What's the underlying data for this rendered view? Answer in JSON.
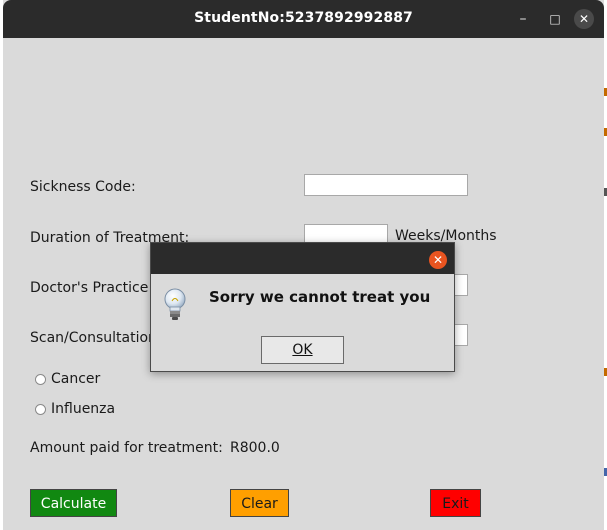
{
  "window": {
    "title": "StudentNo:5237892992887"
  },
  "form": {
    "sickness_code_label": "Sickness Code:",
    "sickness_code_value": "",
    "duration_label": "Duration of Treatment:",
    "duration_value": "",
    "duration_unit": "Weeks/Months",
    "doctor_label": "Doctor's Practice N",
    "scan_label": "Scan/Consultation",
    "radio_options": [
      "Cancer",
      "Influenza"
    ],
    "amount_label": "Amount paid for treatment:",
    "amount_value": "R800.0"
  },
  "buttons": {
    "calculate": "Calculate",
    "clear": "Clear",
    "exit": "Exit"
  },
  "dialog": {
    "message": "Sorry we cannot treat you",
    "ok_label": "OK",
    "icon": "lightbulb-icon"
  },
  "colors": {
    "calculate_bg": "#118811",
    "clear_bg": "#ff9f00",
    "exit_bg": "#ff0000",
    "dialog_close": "#e95420",
    "titlebar": "#2b2b2b"
  }
}
